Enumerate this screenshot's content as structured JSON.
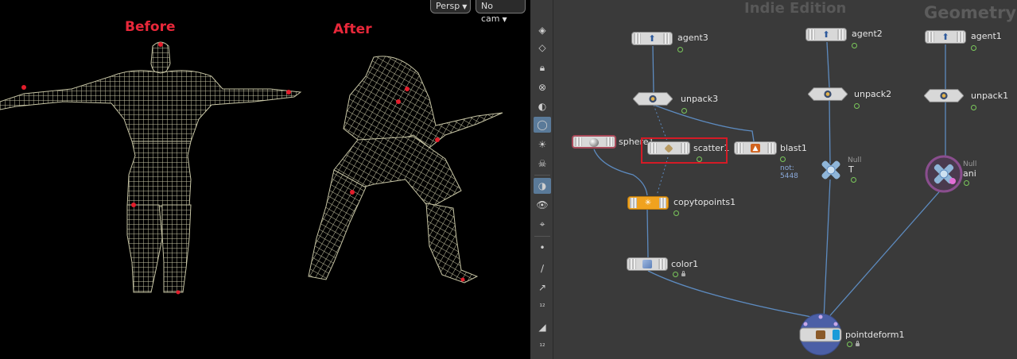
{
  "viewport": {
    "before_label": "Before",
    "after_label": "After",
    "persp_button": "Persp",
    "cam_button": "No cam"
  },
  "network": {
    "watermark_edition": "Indie Edition",
    "watermark_context": "Geometry",
    "blast_note": "not: 5448",
    "null_type": "Null",
    "nodes": {
      "agent3": "agent3",
      "agent2": "agent2",
      "agent1": "agent1",
      "unpack3": "unpack3",
      "unpack2": "unpack2",
      "unpack1": "unpack1",
      "sphere1": "sphere1",
      "scatter1": "scatter1",
      "blast1": "blast1",
      "null_t": "T",
      "null_ani": "ani",
      "copytopoints1": "copytopoints1",
      "color1": "color1",
      "pointdeform1": "pointdeform1"
    }
  },
  "toolbar": {
    "tools": [
      "display-options-icon",
      "ghost-icon",
      "lock-icon",
      "snap-icon",
      "light-icon",
      "bulb-icon",
      "light2-icon",
      "skull-icon",
      "shading-icon",
      "camera-visibility-icon",
      "view-icon",
      "point-icon",
      "brush-icon",
      "select-icon",
      "number-12-icon",
      "paint-icon",
      "number-12b-icon"
    ]
  },
  "colors": {
    "mesh": "#c6c4a4",
    "marker": "#e31d2b",
    "network_bg": "#3a3a3a",
    "wire": "#5d8bc0",
    "copytopoints": "#f0a21e",
    "red_highlight": "#d41b26"
  }
}
